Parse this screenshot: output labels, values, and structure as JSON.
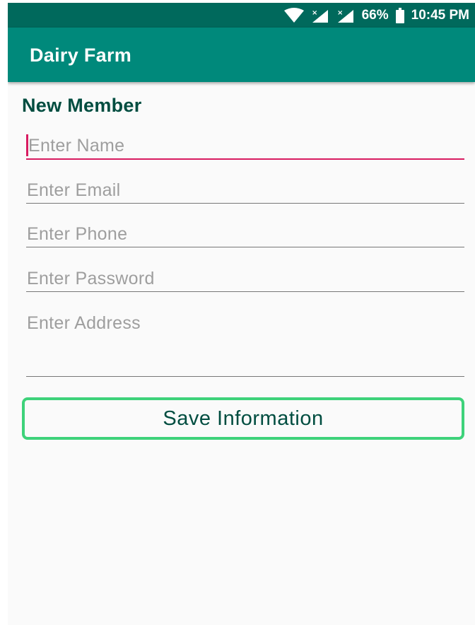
{
  "status_bar": {
    "battery": "66%",
    "time": "10:45 PM"
  },
  "app_bar": {
    "title": "Dairy Farm"
  },
  "form": {
    "heading": "New Member",
    "name_placeholder": "Enter Name",
    "email_placeholder": "Enter Email",
    "phone_placeholder": "Enter Phone",
    "password_placeholder": "Enter Password",
    "address_placeholder": "Enter Address",
    "save_label": "Save Information"
  },
  "colors": {
    "status_bar": "#00695c",
    "app_bar": "#00897b",
    "accent": "#d81b60",
    "button_border": "#3ed27a"
  },
  "icons": [
    "wifi-icon",
    "signal-icon-1",
    "signal-icon-2",
    "battery-icon"
  ]
}
